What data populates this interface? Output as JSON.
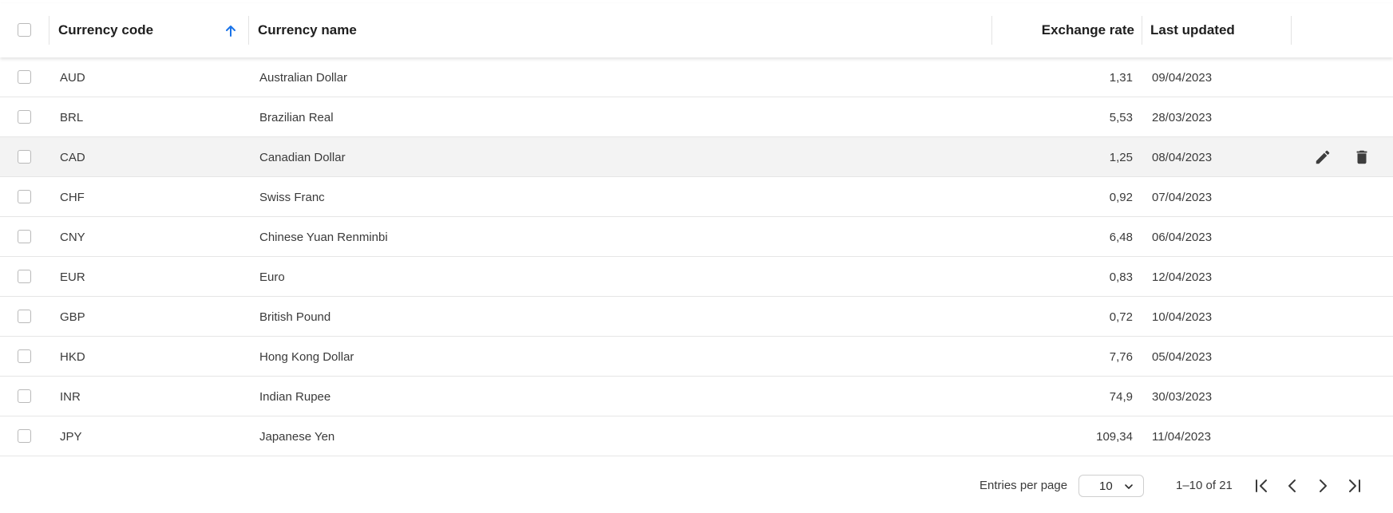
{
  "header": {
    "code_label": "Currency code",
    "name_label": "Currency name",
    "rate_label": "Exchange rate",
    "updated_label": "Last updated",
    "sort_direction": "ascending"
  },
  "rows": [
    {
      "code": "AUD",
      "name": "Australian Dollar",
      "rate": "1,31",
      "updated": "09/04/2023"
    },
    {
      "code": "BRL",
      "name": "Brazilian Real",
      "rate": "5,53",
      "updated": "28/03/2023"
    },
    {
      "code": "CAD",
      "name": "Canadian Dollar",
      "rate": "1,25",
      "updated": "08/04/2023"
    },
    {
      "code": "CHF",
      "name": "Swiss Franc",
      "rate": "0,92",
      "updated": "07/04/2023"
    },
    {
      "code": "CNY",
      "name": "Chinese Yuan Renminbi",
      "rate": "6,48",
      "updated": "06/04/2023"
    },
    {
      "code": "EUR",
      "name": "Euro",
      "rate": "0,83",
      "updated": "12/04/2023"
    },
    {
      "code": "GBP",
      "name": "British Pound",
      "rate": "0,72",
      "updated": "10/04/2023"
    },
    {
      "code": "HKD",
      "name": "Hong Kong Dollar",
      "rate": "7,76",
      "updated": "05/04/2023"
    },
    {
      "code": "INR",
      "name": "Indian Rupee",
      "rate": "74,9",
      "updated": "30/03/2023"
    },
    {
      "code": "JPY",
      "name": "Japanese Yen",
      "rate": "109,34",
      "updated": "11/04/2023"
    }
  ],
  "hovered_row_actions": {
    "row": "CAD",
    "icons": [
      "pencil-icon",
      "trash-icon"
    ]
  },
  "footer": {
    "entries_label": "Entries per page",
    "entries_value": "10",
    "range_text": "1–10 of 21"
  },
  "colors": {
    "accent": "#1a73e8",
    "row_hover": "#f3f3f3",
    "border": "#e6e6e6"
  }
}
